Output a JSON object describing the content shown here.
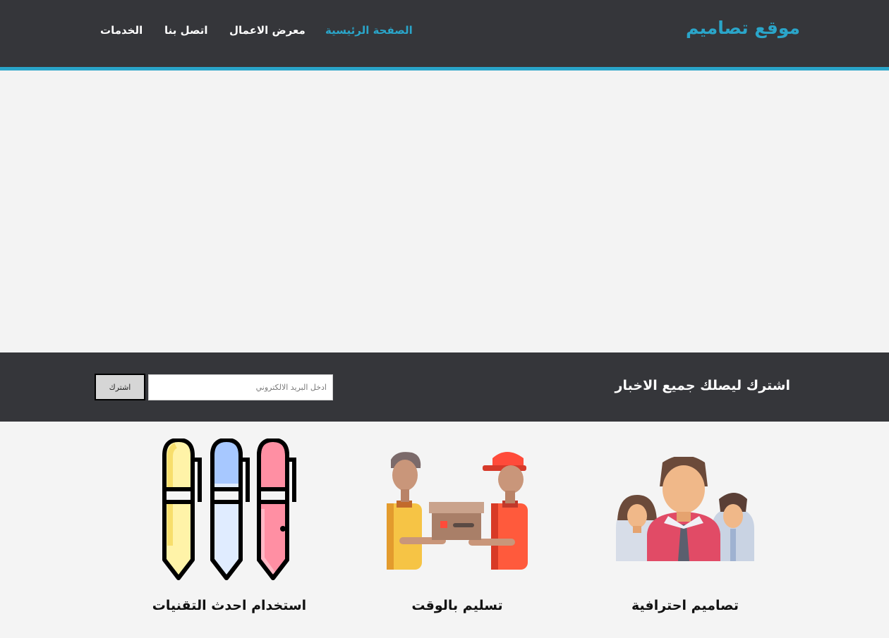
{
  "header": {
    "logo": "موقع تصاميم",
    "nav": [
      {
        "label": "الصفحة الرئيسية",
        "active": true
      },
      {
        "label": "معرض الاعمال",
        "active": false
      },
      {
        "label": "اتصل بنا",
        "active": false
      },
      {
        "label": "الخدمات",
        "active": false
      }
    ]
  },
  "subscribe": {
    "title": "اشترك ليصلك جميع الاخبار",
    "email_placeholder": "ادخل البريد الالكتروني",
    "button_label": "اشترك"
  },
  "features": [
    {
      "title": "تصاميم احترافية",
      "icon": "team-people-icon"
    },
    {
      "title": "تسليم بالوقت",
      "icon": "delivery-package-icon"
    },
    {
      "title": "استخدام احدث التقنيات",
      "icon": "pens-icon"
    }
  ],
  "colors": {
    "accent": "#2aa5c9",
    "dark_bar": "#35363a",
    "background": "#f4f4f4"
  }
}
